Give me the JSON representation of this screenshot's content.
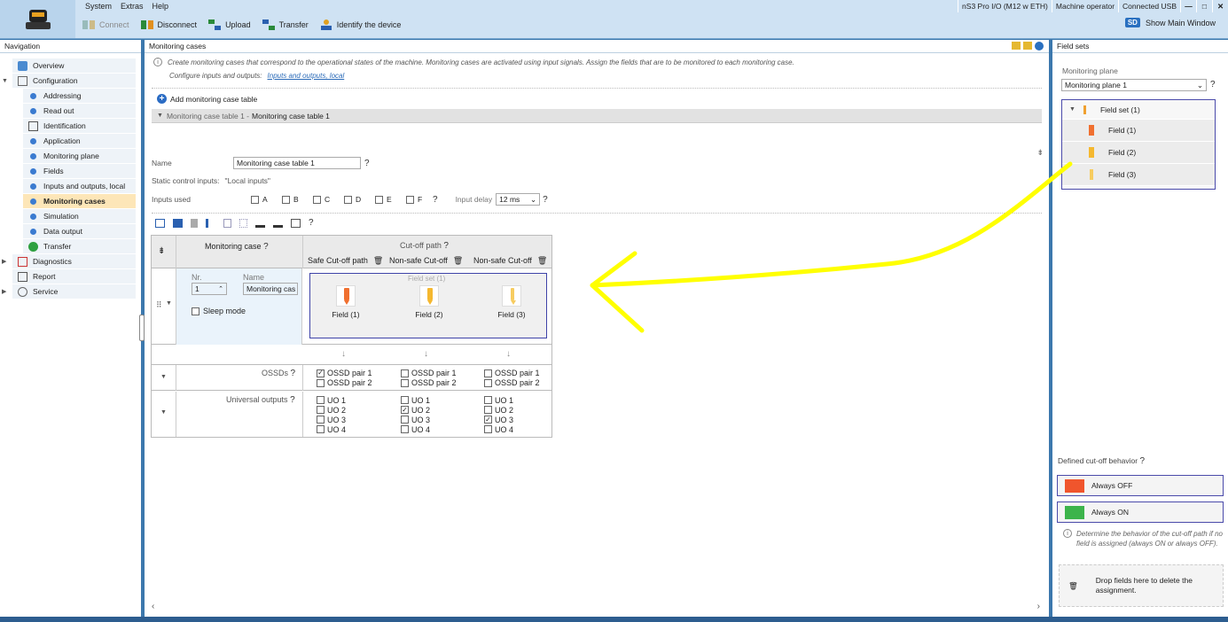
{
  "menu": [
    "System",
    "Extras",
    "Help"
  ],
  "toolbar": {
    "connect": "Connect",
    "disconnect": "Disconnect",
    "upload": "Upload",
    "transfer": "Transfer",
    "identify": "Identify the device"
  },
  "status": {
    "device": "nS3 Pro I/O (M12 w ETH)",
    "user": "Machine operator",
    "connection": "Connected USB",
    "minimize": "—",
    "maximize": "□",
    "close": "✕"
  },
  "show_main": {
    "badge": "SD",
    "label": "Show Main Window"
  },
  "navigation": {
    "title": "Navigation",
    "items": [
      {
        "label": "Overview",
        "level": 1
      },
      {
        "label": "Configuration",
        "level": 1
      },
      {
        "label": "Addressing",
        "level": 2
      },
      {
        "label": "Read out",
        "level": 2
      },
      {
        "label": "Identification",
        "level": 2
      },
      {
        "label": "Application",
        "level": 2
      },
      {
        "label": "Monitoring plane",
        "level": 2
      },
      {
        "label": "Fields",
        "level": 2
      },
      {
        "label": "Inputs and outputs, local",
        "level": 2
      },
      {
        "label": "Monitoring cases",
        "level": 2,
        "selected": true
      },
      {
        "label": "Simulation",
        "level": 2
      },
      {
        "label": "Data output",
        "level": 2
      },
      {
        "label": "Transfer",
        "level": 2
      },
      {
        "label": "Diagnostics",
        "level": 1
      },
      {
        "label": "Report",
        "level": 1
      },
      {
        "label": "Service",
        "level": 1
      }
    ]
  },
  "main": {
    "title": "Monitoring cases",
    "info": "Create monitoring cases that correspond to the operational states of the machine. Monitoring cases are activated using input signals. Assign the fields that are to be monitored to each monitoring case.",
    "io_prefix": "Configure inputs and outputs:",
    "io_link": "Inputs and outputs, local",
    "add_table": "Add monitoring case table",
    "section_prefix": "Monitoring case table 1 -",
    "section_title": "Monitoring case table 1",
    "name_label": "Name",
    "name_value": "Monitoring case table 1",
    "static_label": "Static control inputs:",
    "static_value": "\"Local inputs\"",
    "inputs_label": "Inputs used",
    "inputs": [
      "A",
      "B",
      "C",
      "D",
      "E",
      "F"
    ],
    "delay_label": "Input delay",
    "delay_value": "12 ms",
    "table": {
      "col_case": "Monitoring case",
      "col_cutoff": "Cut-off path",
      "paths": [
        "Safe Cut-off path",
        "Non-safe Cut-off",
        "Non-safe Cut-off"
      ],
      "nr_label": "Nr.",
      "name_label": "Name",
      "nr_value": "1",
      "case_name": "Monitoring cas",
      "sleep_mode": "Sleep mode",
      "fieldset_label": "Field set (1)",
      "fields": [
        "Field (1)",
        "Field (2)",
        "Field (3)"
      ],
      "ossds_label": "OSSDs",
      "ossd_options": [
        "OSSD pair 1",
        "OSSD pair 2"
      ],
      "ossd_checked": [
        [
          true,
          false
        ],
        [
          false,
          false
        ],
        [
          false,
          false
        ]
      ],
      "uo_label": "Universal outputs",
      "uo_options": [
        "UO 1",
        "UO 2",
        "UO 3",
        "UO 4"
      ],
      "uo_checked": [
        [
          false,
          false,
          false,
          false
        ],
        [
          false,
          true,
          false,
          false
        ],
        [
          false,
          false,
          true,
          false
        ]
      ]
    }
  },
  "field_sets": {
    "title": "Field sets",
    "plane_label": "Monitoring plane",
    "plane_value": "Monitoring plane 1",
    "set_name": "Field set (1)",
    "fields": [
      "Field (1)",
      "Field (2)",
      "Field (3)"
    ],
    "behavior_title": "Defined cut-off behavior",
    "always_off": "Always OFF",
    "always_on": "Always ON",
    "behavior_note": "Determine the behavior of the cut-off path if no field is assigned (always ON or always OFF).",
    "drop_text": "Drop fields here to delete the assignment."
  },
  "colors": {
    "accent": "#3c78ad",
    "off": "#f0552d",
    "on": "#3cb44b",
    "field_orange": "#f07030",
    "field_yellow": "#f5b830",
    "annotation": "#ffff00"
  }
}
